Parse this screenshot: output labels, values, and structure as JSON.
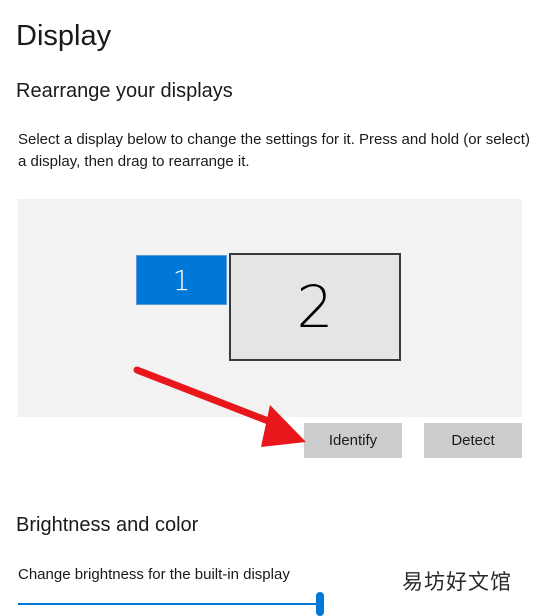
{
  "page": {
    "title": "Display"
  },
  "rearrange": {
    "title": "Rearrange your displays",
    "description": "Select a display below to change the settings for it. Press and hold (or select) a display, then drag to rearrange it.",
    "monitors": [
      {
        "label": "1",
        "selected": true,
        "color": "#0078d7"
      },
      {
        "label": "2",
        "selected": false,
        "color": "#e5e5e5"
      }
    ],
    "identify_label": "Identify",
    "detect_label": "Detect",
    "annotation_arrow_color": "#e8171b"
  },
  "brightness": {
    "title": "Brightness and color",
    "description": "Change brightness for the built-in display",
    "slider_level": 1.0
  },
  "watermark": {
    "text": "易坊好文馆"
  }
}
